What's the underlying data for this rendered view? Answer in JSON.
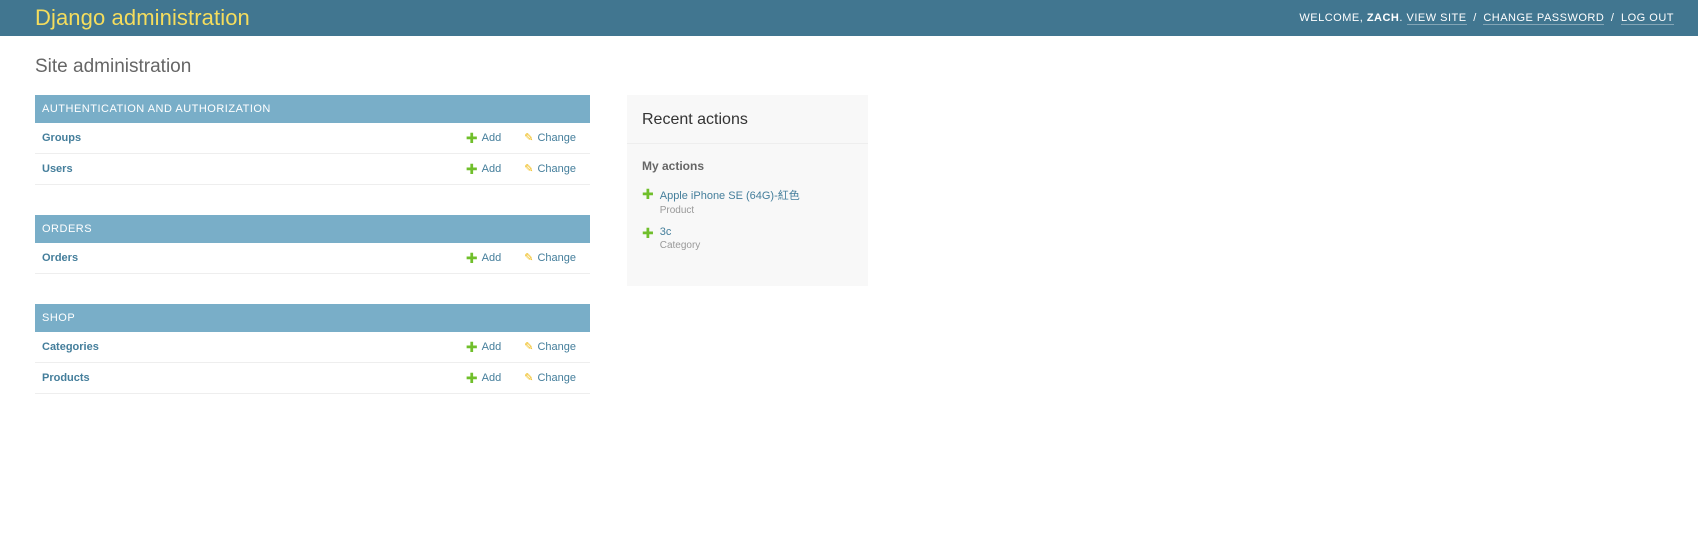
{
  "header": {
    "branding": "Django administration",
    "welcome": "WELCOME, ",
    "username": "ZACH",
    "after_username": ".",
    "view_site": "VIEW SITE",
    "change_password": "CHANGE PASSWORD",
    "log_out": "LOG OUT",
    "separator": "/"
  },
  "page_title": "Site administration",
  "apps": [
    {
      "caption": "AUTHENTICATION AND AUTHORIZATION",
      "models": [
        {
          "name": "Groups",
          "add": "Add",
          "change": "Change"
        },
        {
          "name": "Users",
          "add": "Add",
          "change": "Change"
        }
      ]
    },
    {
      "caption": "ORDERS",
      "models": [
        {
          "name": "Orders",
          "add": "Add",
          "change": "Change"
        }
      ]
    },
    {
      "caption": "SHOP",
      "models": [
        {
          "name": "Categories",
          "add": "Add",
          "change": "Change"
        },
        {
          "name": "Products",
          "add": "Add",
          "change": "Change"
        }
      ]
    }
  ],
  "recent_actions": {
    "title": "Recent actions",
    "subtitle": "My actions",
    "items": [
      {
        "object": "Apple iPhone SE (64G)-紅色",
        "content_type": "Product",
        "icon": "plus-icon"
      },
      {
        "object": "3c",
        "content_type": "Category",
        "icon": "plus-icon"
      }
    ]
  },
  "colors": {
    "header_bg": "#417690",
    "branding": "#f5dd5d",
    "caption_bg": "#79aec8",
    "link": "#447e9b",
    "add_icon": "#70bf2b",
    "change_icon": "#efb80b"
  }
}
